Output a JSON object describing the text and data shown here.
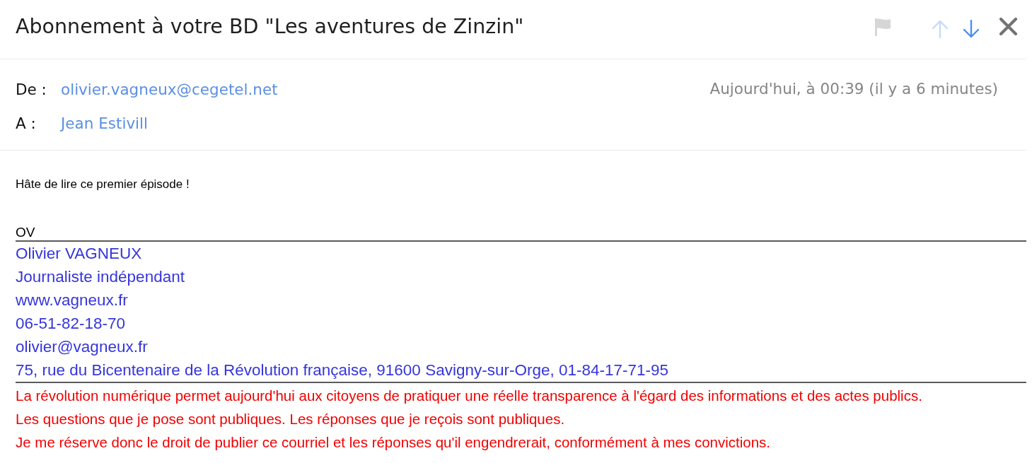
{
  "header": {
    "subject": "Abonnement à votre BD \"Les aventures de Zinzin\"",
    "flagged": false,
    "previous": {
      "disabled": true
    },
    "next": {
      "disabled": false
    }
  },
  "meta": {
    "fields": [
      {
        "label": "De :",
        "value": "olivier.vagneux@cegetel.net"
      },
      {
        "label": "A :",
        "value": "Jean Estivill"
      }
    ],
    "date": "Aujourd'hui, à 00:39 (il y a 6 minutes)"
  },
  "body": {
    "message": "Hâte de lire ce premier épisode !",
    "initials": "OV",
    "signature": [
      "Olivier VAGNEUX",
      "Journaliste indépendant",
      "www.vagneux.fr",
      "06-51-82-18-70",
      "olivier@vagneux.fr",
      "75, rue du Bicentenaire de la Révolution française, 91600 Savigny-sur-Orge, 01-84-17-71-95"
    ],
    "disclaimer": [
      "La révolution numérique permet aujourd'hui aux citoyens de pratiquer une réelle transparence à l'égard des informations et des actes publics.",
      "Les questions que je pose sont publiques. Les réponses que je reçois sont publiques.",
      "Je me réserve donc le droit de publier ce courriel et les réponses qu'il engendrerait, conformément à mes convictions."
    ]
  }
}
